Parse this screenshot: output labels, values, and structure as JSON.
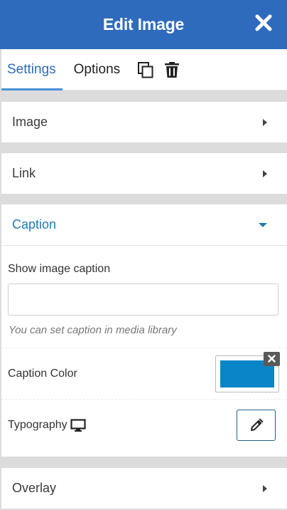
{
  "header": {
    "title": "Edit Image"
  },
  "tabs": [
    {
      "label": "Settings",
      "active": true
    },
    {
      "label": "Options",
      "active": false
    }
  ],
  "toolbar": {
    "icons": [
      "duplicate-icon",
      "trash-icon",
      "close-icon"
    ]
  },
  "sections": {
    "image": {
      "label": "Image",
      "expanded": false
    },
    "link": {
      "label": "Link",
      "expanded": false
    },
    "caption": {
      "label": "Caption",
      "expanded": true
    },
    "overlay": {
      "label": "Overlay",
      "expanded": false
    }
  },
  "caption_panel": {
    "show_caption_label": "Show image caption",
    "caption_value": "",
    "caption_placeholder": "",
    "hint": "You can set caption in media library",
    "caption_color_label": "Caption Color",
    "caption_color": "#0a86c8",
    "typography_label": "Typography",
    "typography_device_icon": "desktop-icon",
    "typography_edit_icon": "pencil-icon"
  },
  "colors": {
    "header": "#2f6bbd",
    "accent": "#1f7ab3",
    "panel_bg": "#ffffff",
    "gutter": "#dcdcdc"
  }
}
